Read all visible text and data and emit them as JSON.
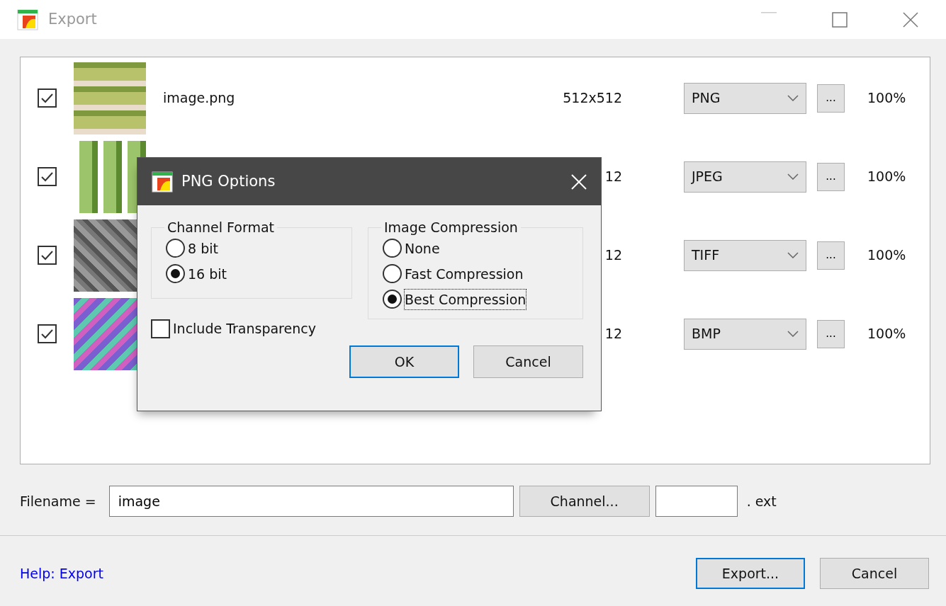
{
  "window": {
    "title": "Export"
  },
  "files": [
    {
      "checked": true,
      "name": "image.png",
      "size": "512x512",
      "format": "PNG",
      "options_button": "...",
      "quality": "100%"
    },
    {
      "checked": true,
      "size": "12",
      "format": "JPEG",
      "options_button": "...",
      "quality": "100%"
    },
    {
      "checked": true,
      "size": "12",
      "format": "TIFF",
      "options_button": "...",
      "quality": "100%"
    },
    {
      "checked": true,
      "size": "12",
      "format": "BMP",
      "options_button": "...",
      "quality": "100%"
    }
  ],
  "filename": {
    "label": "Filename =",
    "value": "image",
    "channel_button": "Channel...",
    "extension_label": ". ext"
  },
  "help_link": "Help: Export",
  "buttons": [
    {
      "label": "Export...",
      "default": true
    },
    {
      "label": "Cancel",
      "default": false
    }
  ],
  "dialog": {
    "title": "PNG Options",
    "channel_format": {
      "title": "Channel Format",
      "options": [
        {
          "label": "8 bit",
          "selected": false
        },
        {
          "label": "16 bit",
          "selected": true
        }
      ]
    },
    "image_compression": {
      "title": "Image Compression",
      "options": [
        {
          "label": "None",
          "selected": false,
          "focused": false
        },
        {
          "label": "Fast Compression",
          "selected": false,
          "focused": false
        },
        {
          "label": "Best Compression",
          "selected": true,
          "focused": true
        }
      ]
    },
    "include_transparency": {
      "label": "Include Transparency",
      "checked": false
    },
    "buttons": [
      {
        "label": "OK",
        "default": true
      },
      {
        "label": "Cancel",
        "default": false
      }
    ]
  }
}
